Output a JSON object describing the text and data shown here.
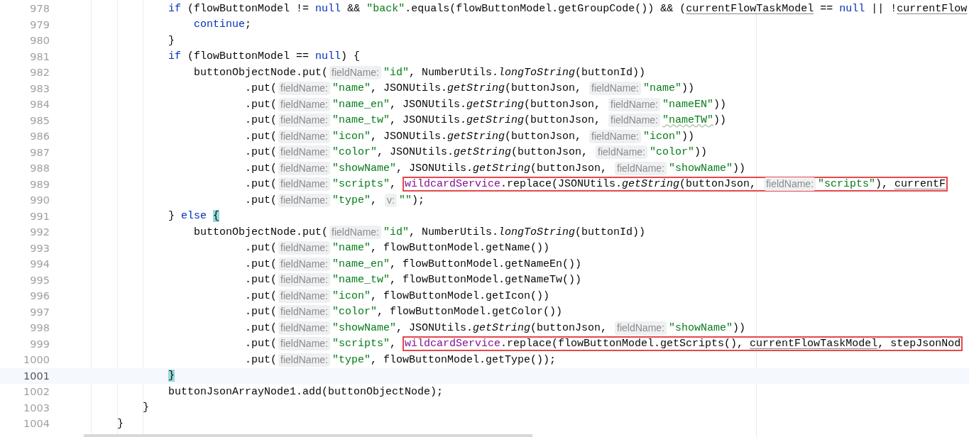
{
  "editor": {
    "lines": [
      {
        "number": "978",
        "current": false,
        "tokens": [
          {
            "kind": "kw",
            "text": "                if"
          },
          {
            "kind": "plain",
            "text": " (flowButtonModel != "
          },
          {
            "kind": "kw",
            "text": "null"
          },
          {
            "kind": "plain",
            "text": " && "
          },
          {
            "kind": "str",
            "text": "\"back\""
          },
          {
            "kind": "plain",
            "text": ".equals(flowButtonModel.getGroupCode()) && ("
          },
          {
            "kind": "ref",
            "text": "currentFlowTaskModel"
          },
          {
            "kind": "plain",
            "text": " == "
          },
          {
            "kind": "kw",
            "text": "null"
          },
          {
            "kind": "plain",
            "text": " || !"
          },
          {
            "kind": "ref",
            "text": "currentFlow"
          }
        ]
      },
      {
        "number": "979",
        "current": false,
        "tokens": [
          {
            "kind": "kw",
            "text": "                    continue"
          },
          {
            "kind": "plain",
            "text": ";"
          }
        ]
      },
      {
        "number": "980",
        "current": false,
        "tokens": [
          {
            "kind": "plain",
            "text": "                }"
          }
        ]
      },
      {
        "number": "981",
        "current": false,
        "tokens": [
          {
            "kind": "kw",
            "text": "                if"
          },
          {
            "kind": "plain",
            "text": " (flowButtonModel == "
          },
          {
            "kind": "kw",
            "text": "null"
          },
          {
            "kind": "plain",
            "text": ") {"
          }
        ]
      },
      {
        "number": "982",
        "current": false,
        "tokens": [
          {
            "kind": "plain",
            "text": "                    buttonObjectNode.put("
          },
          {
            "kind": "hint",
            "text": "fieldName:"
          },
          {
            "kind": "str",
            "text": "\"id\""
          },
          {
            "kind": "plain",
            "text": ", NumberUtils."
          },
          {
            "kind": "static",
            "text": "longToString"
          },
          {
            "kind": "plain",
            "text": "(buttonId))"
          }
        ]
      },
      {
        "number": "983",
        "current": false,
        "tokens": [
          {
            "kind": "plain",
            "text": "                            .put("
          },
          {
            "kind": "hint",
            "text": "fieldName:"
          },
          {
            "kind": "str",
            "text": "\"name\""
          },
          {
            "kind": "plain",
            "text": ", JSONUtils."
          },
          {
            "kind": "static",
            "text": "getString"
          },
          {
            "kind": "plain",
            "text": "(buttonJson, "
          },
          {
            "kind": "hint",
            "text": "fieldName:"
          },
          {
            "kind": "str",
            "text": "\"name\""
          },
          {
            "kind": "plain",
            "text": "))"
          }
        ]
      },
      {
        "number": "984",
        "current": false,
        "tokens": [
          {
            "kind": "plain",
            "text": "                            .put("
          },
          {
            "kind": "hint",
            "text": "fieldName:"
          },
          {
            "kind": "str",
            "text": "\"name_en\""
          },
          {
            "kind": "plain",
            "text": ", JSONUtils."
          },
          {
            "kind": "static",
            "text": "getString"
          },
          {
            "kind": "plain",
            "text": "(buttonJson, "
          },
          {
            "kind": "hint",
            "text": "fieldName:"
          },
          {
            "kind": "str",
            "text": "\"nameEN\""
          },
          {
            "kind": "plain",
            "text": "))"
          }
        ]
      },
      {
        "number": "985",
        "current": false,
        "tokens": [
          {
            "kind": "plain",
            "text": "                            .put("
          },
          {
            "kind": "hint",
            "text": "fieldName:"
          },
          {
            "kind": "str",
            "text": "\"name_tw\""
          },
          {
            "kind": "plain",
            "text": ", JSONUtils."
          },
          {
            "kind": "static",
            "text": "getString"
          },
          {
            "kind": "plain",
            "text": "(buttonJson, "
          },
          {
            "kind": "hint",
            "text": "fieldName:"
          },
          {
            "kind": "typo",
            "text": "\"nameTW\""
          },
          {
            "kind": "plain",
            "text": "))"
          }
        ]
      },
      {
        "number": "986",
        "current": false,
        "tokens": [
          {
            "kind": "plain",
            "text": "                            .put("
          },
          {
            "kind": "hint",
            "text": "fieldName:"
          },
          {
            "kind": "str",
            "text": "\"icon\""
          },
          {
            "kind": "plain",
            "text": ", JSONUtils."
          },
          {
            "kind": "static",
            "text": "getString"
          },
          {
            "kind": "plain",
            "text": "(buttonJson, "
          },
          {
            "kind": "hint",
            "text": "fieldName:"
          },
          {
            "kind": "str",
            "text": "\"icon\""
          },
          {
            "kind": "plain",
            "text": "))"
          }
        ]
      },
      {
        "number": "987",
        "current": false,
        "tokens": [
          {
            "kind": "plain",
            "text": "                            .put("
          },
          {
            "kind": "hint",
            "text": "fieldName:"
          },
          {
            "kind": "str",
            "text": "\"color\""
          },
          {
            "kind": "plain",
            "text": ", JSONUtils."
          },
          {
            "kind": "static",
            "text": "getString"
          },
          {
            "kind": "plain",
            "text": "(buttonJson, "
          },
          {
            "kind": "hint",
            "text": "fieldName:"
          },
          {
            "kind": "str",
            "text": "\"color\""
          },
          {
            "kind": "plain",
            "text": "))"
          }
        ]
      },
      {
        "number": "988",
        "current": false,
        "tokens": [
          {
            "kind": "plain",
            "text": "                            .put("
          },
          {
            "kind": "hint",
            "text": "fieldName:"
          },
          {
            "kind": "str",
            "text": "\"showName\""
          },
          {
            "kind": "plain",
            "text": ", JSONUtils."
          },
          {
            "kind": "static",
            "text": "getString"
          },
          {
            "kind": "plain",
            "text": "(buttonJson, "
          },
          {
            "kind": "hint",
            "text": "fieldName:"
          },
          {
            "kind": "str",
            "text": "\"showName\""
          },
          {
            "kind": "plain",
            "text": "))"
          }
        ]
      },
      {
        "number": "989",
        "current": false,
        "tokens": [
          {
            "kind": "plain",
            "text": "                            .put("
          },
          {
            "kind": "hint",
            "text": "fieldName:"
          },
          {
            "kind": "str",
            "text": "\"scripts\""
          },
          {
            "kind": "plain",
            "text": ", "
          }
        ],
        "boxed": [
          {
            "kind": "field",
            "text": "wildcardService"
          },
          {
            "kind": "plain",
            "text": ".replace(JSONUtils."
          },
          {
            "kind": "static",
            "text": "getString"
          },
          {
            "kind": "plain",
            "text": "(buttonJson, "
          },
          {
            "kind": "hint",
            "text": "fieldName:"
          },
          {
            "kind": "str",
            "text": "\"scripts\""
          },
          {
            "kind": "plain",
            "text": "), "
          },
          {
            "kind": "ref",
            "text": "currentF"
          }
        ]
      },
      {
        "number": "990",
        "current": false,
        "tokens": [
          {
            "kind": "plain",
            "text": "                            .put("
          },
          {
            "kind": "hint",
            "text": "fieldName:"
          },
          {
            "kind": "str",
            "text": "\"type\""
          },
          {
            "kind": "plain",
            "text": ", "
          },
          {
            "kind": "hint",
            "text": "v:"
          },
          {
            "kind": "str",
            "text": "\"\""
          },
          {
            "kind": "plain",
            "text": ");"
          }
        ]
      },
      {
        "number": "991",
        "current": false,
        "tokens": [
          {
            "kind": "plain",
            "text": "                }"
          },
          {
            "kind": "kw",
            "text": " else"
          },
          {
            "kind": "brace",
            "text": " {"
          }
        ]
      },
      {
        "number": "992",
        "current": false,
        "tokens": [
          {
            "kind": "plain",
            "text": "                    buttonObjectNode.put("
          },
          {
            "kind": "hint",
            "text": "fieldName:"
          },
          {
            "kind": "str",
            "text": "\"id\""
          },
          {
            "kind": "plain",
            "text": ", NumberUtils."
          },
          {
            "kind": "static",
            "text": "longToString"
          },
          {
            "kind": "plain",
            "text": "(buttonId))"
          }
        ]
      },
      {
        "number": "993",
        "current": false,
        "tokens": [
          {
            "kind": "plain",
            "text": "                            .put("
          },
          {
            "kind": "hint",
            "text": "fieldName:"
          },
          {
            "kind": "str",
            "text": "\"name\""
          },
          {
            "kind": "plain",
            "text": ", flowButtonModel.getName())"
          }
        ]
      },
      {
        "number": "994",
        "current": false,
        "tokens": [
          {
            "kind": "plain",
            "text": "                            .put("
          },
          {
            "kind": "hint",
            "text": "fieldName:"
          },
          {
            "kind": "str",
            "text": "\"name_en\""
          },
          {
            "kind": "plain",
            "text": ", flowButtonModel.getNameEn())"
          }
        ]
      },
      {
        "number": "995",
        "current": false,
        "tokens": [
          {
            "kind": "plain",
            "text": "                            .put("
          },
          {
            "kind": "hint",
            "text": "fieldName:"
          },
          {
            "kind": "str",
            "text": "\"name_tw\""
          },
          {
            "kind": "plain",
            "text": ", flowButtonModel.getNameTw())"
          }
        ]
      },
      {
        "number": "996",
        "current": false,
        "tokens": [
          {
            "kind": "plain",
            "text": "                            .put("
          },
          {
            "kind": "hint",
            "text": "fieldName:"
          },
          {
            "kind": "str",
            "text": "\"icon\""
          },
          {
            "kind": "plain",
            "text": ", flowButtonModel.getIcon())"
          }
        ]
      },
      {
        "number": "997",
        "current": false,
        "tokens": [
          {
            "kind": "plain",
            "text": "                            .put("
          },
          {
            "kind": "hint",
            "text": "fieldName:"
          },
          {
            "kind": "str",
            "text": "\"color\""
          },
          {
            "kind": "plain",
            "text": ", flowButtonModel.getColor())"
          }
        ]
      },
      {
        "number": "998",
        "current": false,
        "tokens": [
          {
            "kind": "plain",
            "text": "                            .put("
          },
          {
            "kind": "hint",
            "text": "fieldName:"
          },
          {
            "kind": "str",
            "text": "\"showName\""
          },
          {
            "kind": "plain",
            "text": ", JSONUtils."
          },
          {
            "kind": "static",
            "text": "getString"
          },
          {
            "kind": "plain",
            "text": "(buttonJson, "
          },
          {
            "kind": "hint",
            "text": "fieldName:"
          },
          {
            "kind": "str",
            "text": "\"showName\""
          },
          {
            "kind": "plain",
            "text": "))"
          }
        ]
      },
      {
        "number": "999",
        "current": false,
        "tokens": [
          {
            "kind": "plain",
            "text": "                            .put("
          },
          {
            "kind": "hint",
            "text": "fieldName:"
          },
          {
            "kind": "str",
            "text": "\"scripts\""
          },
          {
            "kind": "plain",
            "text": ", "
          }
        ],
        "boxed": [
          {
            "kind": "field",
            "text": "wildcardService"
          },
          {
            "kind": "plain",
            "text": ".replace(flowButtonModel.getScripts(), "
          },
          {
            "kind": "ref",
            "text": "currentFlowTaskModel"
          },
          {
            "kind": "plain",
            "text": ", stepJsonNod"
          }
        ]
      },
      {
        "number": "1000",
        "current": false,
        "tokens": [
          {
            "kind": "plain",
            "text": "                            .put("
          },
          {
            "kind": "hint",
            "text": "fieldName:"
          },
          {
            "kind": "str",
            "text": "\"type\""
          },
          {
            "kind": "plain",
            "text": ", flowButtonModel.getType());"
          }
        ]
      },
      {
        "number": "1001",
        "current": true,
        "tokens": [
          {
            "kind": "brace",
            "text": "                }"
          }
        ]
      },
      {
        "number": "1002",
        "current": false,
        "tokens": [
          {
            "kind": "plain",
            "text": "                buttonJsonArrayNode1.add(buttonObjectNode);"
          }
        ]
      },
      {
        "number": "1003",
        "current": false,
        "tokens": [
          {
            "kind": "plain",
            "text": "            }"
          }
        ]
      },
      {
        "number": "1004",
        "current": false,
        "tokens": [
          {
            "kind": "plain",
            "text": "        }"
          }
        ]
      }
    ]
  }
}
